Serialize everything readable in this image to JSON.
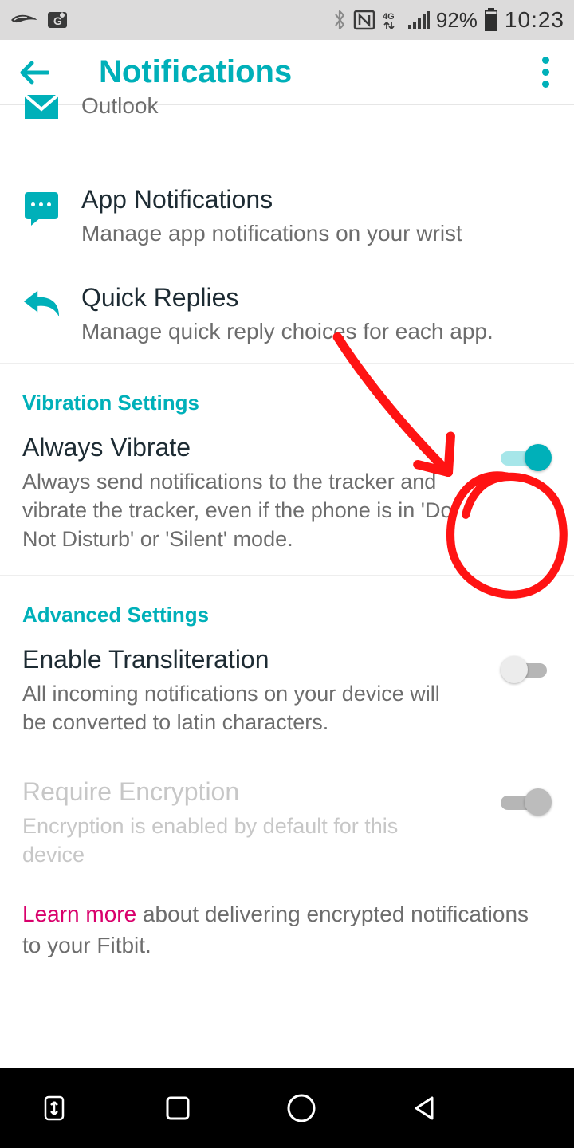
{
  "statusbar": {
    "battery_percent": "92%",
    "time": "10:23",
    "icons": [
      "bird-icon",
      "maps-icon",
      "bluetooth-icon",
      "nfc-icon",
      "4g-icon",
      "signal-icon",
      "battery-icon"
    ]
  },
  "appbar": {
    "title": "Notifications"
  },
  "rows": {
    "emails": {
      "title": "Emails",
      "subtitle": "Outlook"
    },
    "appnotif": {
      "title": "App Notifications",
      "subtitle": "Manage app notifications on your wrist"
    },
    "quick": {
      "title": "Quick Replies",
      "subtitle": "Manage quick reply choices for each app."
    }
  },
  "sections": {
    "vibration_title": "Vibration Settings",
    "advanced_title": "Advanced Settings"
  },
  "settings": {
    "always_vibrate": {
      "title": "Always Vibrate",
      "subtitle": "Always send notifications to the tracker and vibrate the tracker, even if the phone is in 'Do Not Disturb' or 'Silent' mode.",
      "enabled": true
    },
    "transliteration": {
      "title": "Enable Transliteration",
      "subtitle": "All incoming notifications on your device will be converted to latin characters.",
      "enabled": false
    },
    "encryption": {
      "title": "Require Encryption",
      "subtitle": "Encryption is enabled by default for this device",
      "enabled": false,
      "disabled": true
    }
  },
  "learn_more": {
    "link": "Learn more",
    "text": " about delivering encrypted notifications to your Fitbit."
  },
  "annotation": {
    "type": "hand-drawn-circle-and-arrow",
    "color": "#ff0000",
    "target": "always-vibrate-toggle"
  }
}
